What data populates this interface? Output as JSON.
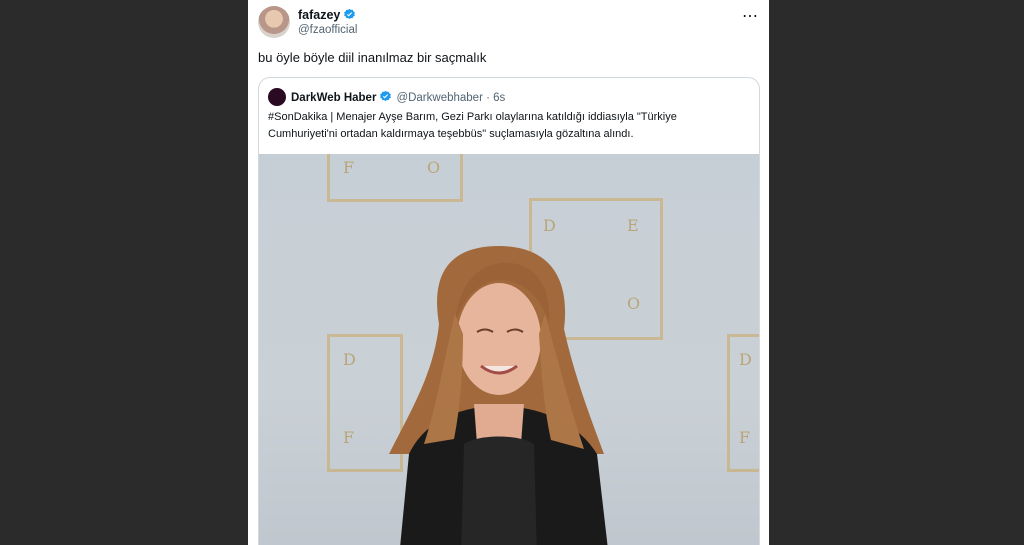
{
  "tweet": {
    "author_name": "fafazey",
    "author_handle": "@fzaofficial",
    "more_icon": "⋯",
    "text": "bu öyle böyle diil inanılmaz bir saçmalık"
  },
  "quoted": {
    "author_name": "DarkWeb Haber",
    "author_handle": "@Darkwebhaber · 6s",
    "text": "#SonDakika | Menajer Ayşe Barım, Gezi Parkı olaylarına katıldığı iddiasıyla \"Türkiye Cumhuriyeti'ni ortadan kaldırmaya teşebbüs\" suçlamasıyla gözaltına alındı."
  },
  "colors": {
    "verified": "#1d9bf0",
    "background": "#2b2b2b",
    "gold": "#c9b487"
  },
  "icons": {
    "verified": "verified-badge-icon",
    "more": "more-options-icon"
  }
}
